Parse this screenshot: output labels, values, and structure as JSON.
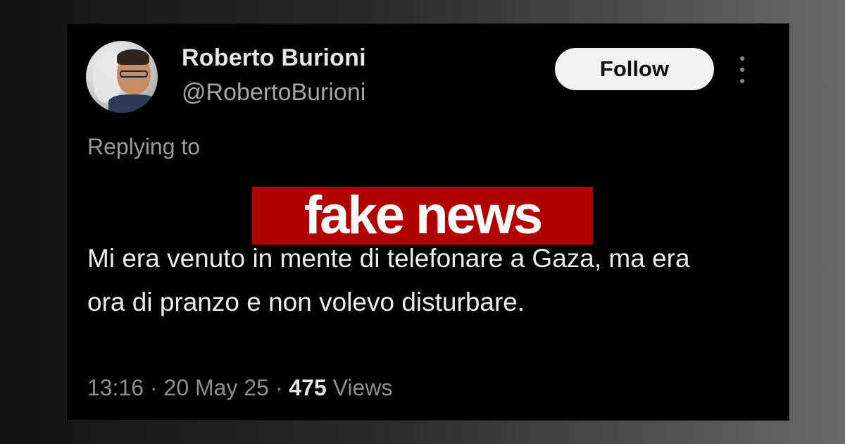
{
  "tweet": {
    "author_name": "Roberto Burioni",
    "author_handle": "@RobertoBurioni",
    "follow_label": "Follow",
    "replying_to_label": "Replying to",
    "text": "Mi era venuto in mente di telefonare a Gaza, ma era ora di pranzo e non volevo disturbare.",
    "time": "13:16",
    "date": "20 May 25",
    "views_count": "475",
    "views_label": "Views",
    "separator": "·"
  },
  "overlay": {
    "label": "fake news",
    "color": "#b00000"
  },
  "icons": {
    "more": "more-vertical-icon"
  }
}
